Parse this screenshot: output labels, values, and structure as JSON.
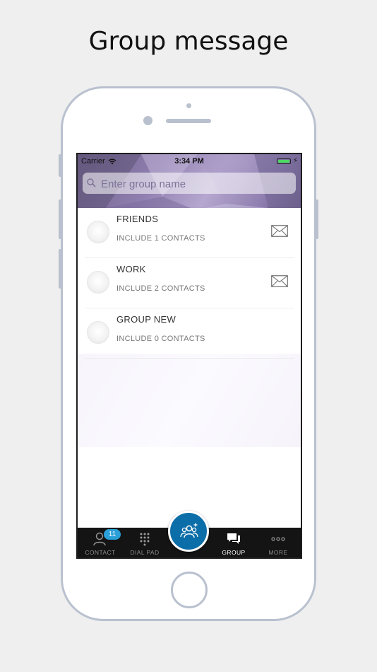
{
  "headline": "Group message",
  "status_bar": {
    "carrier": "Carrier",
    "time": "3:34 PM"
  },
  "search": {
    "placeholder": "Enter group name"
  },
  "groups": [
    {
      "name": "FRIENDS",
      "subtitle": "INCLUDE 1 CONTACTS",
      "has_mail_icon": true
    },
    {
      "name": "WORK",
      "subtitle": "INCLUDE 2 CONTACTS",
      "has_mail_icon": true
    },
    {
      "name": "GROUP NEW",
      "subtitle": "INCLUDE 0 CONTACTS",
      "has_mail_icon": false
    }
  ],
  "tabbar": {
    "items": [
      {
        "label": "CONTACT",
        "icon": "person-icon",
        "badge": "11"
      },
      {
        "label": "DIAL PAD",
        "icon": "dialpad-icon"
      },
      {
        "label": "GROUP",
        "icon": "chat-bubbles-icon",
        "active": true
      },
      {
        "label": "MORE",
        "icon": "more-dots-icon"
      }
    ],
    "center_button_icon": "group-add-icon"
  },
  "colors": {
    "accent": "#0c6ea8",
    "badge": "#2a9fd8",
    "tabbar_bg": "#141414",
    "hero_purple": "#8f7fb0"
  }
}
